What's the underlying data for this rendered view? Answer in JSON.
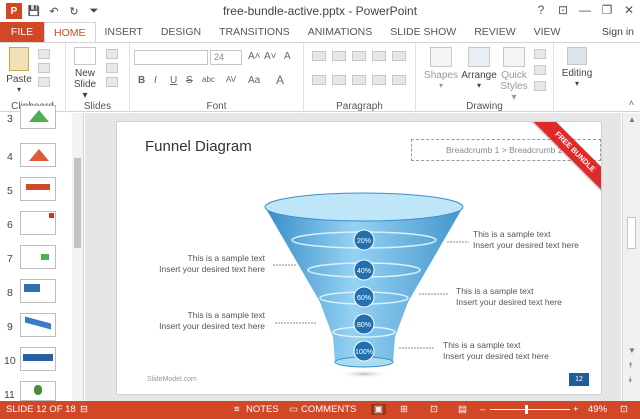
{
  "window": {
    "title": "free-bundle-active.pptx - PowerPoint",
    "help": "?",
    "minimize": "—",
    "restore": "❐",
    "close": "✕",
    "ribbon_display": "⊡"
  },
  "qat": {
    "save": "💾",
    "undo": "↶",
    "redo": "↻",
    "customize": "⏷"
  },
  "tabs": [
    "FILE",
    "HOME",
    "INSERT",
    "DESIGN",
    "TRANSITIONS",
    "ANIMATIONS",
    "SLIDE SHOW",
    "REVIEW",
    "VIEW"
  ],
  "signin": "Sign in",
  "ribbon": {
    "clipboard": {
      "paste": "Paste",
      "label": "Clipboard"
    },
    "slides": {
      "new_slide_1": "New",
      "new_slide_2": "Slide ▾",
      "label": "Slides"
    },
    "font": {
      "size": "24",
      "grow": "A˄",
      "shrink": "A˅",
      "bold": "B",
      "italic": "I",
      "underline": "U",
      "strike": "S",
      "shadow": "abc",
      "spacing": "AV",
      "case": "Aa",
      "color": "A",
      "clear": "A",
      "label": "Font"
    },
    "paragraph": {
      "label": "Paragraph"
    },
    "drawing": {
      "shapes": "Shapes",
      "arrange": "Arrange",
      "quick_styles_1": "Quick",
      "quick_styles_2": "Styles ▾",
      "label": "Drawing"
    },
    "editing": {
      "label": "Editing"
    }
  },
  "thumbnails": [
    "3",
    "4",
    "5",
    "6",
    "7",
    "8",
    "9",
    "10",
    "11"
  ],
  "selected_thumb": "7",
  "slide": {
    "title": "Funnel Diagram",
    "breadcrumb": "Breadcrumb 1 > Breadcrumb 2",
    "ribbon_badge": "FREE BUNDLE",
    "footer": "SlideModel.com",
    "page_number": "12",
    "funnel_levels": [
      "20%",
      "40%",
      "60%",
      "80%",
      "100%"
    ],
    "callouts": [
      {
        "line1": "This is a sample text",
        "line2": "Insert your desired text here"
      },
      {
        "line1": "This is a sample text",
        "line2": "Insert your desired text here"
      },
      {
        "line1": "This is a sample text",
        "line2": "Insert your desired text here"
      },
      {
        "line1": "This is a sample text",
        "line2": "Insert your desired text here"
      },
      {
        "line1": "This is a sample text",
        "line2": "Insert your desired text here"
      }
    ]
  },
  "statusbar": {
    "slide_of": "SLIDE 12 OF 18",
    "notes": "NOTES",
    "comments": "COMMENTS",
    "zoom": "49%"
  },
  "colors": {
    "accent": "#d24726",
    "funnel": "#5aa9d6",
    "badge": "#e02a2a"
  }
}
